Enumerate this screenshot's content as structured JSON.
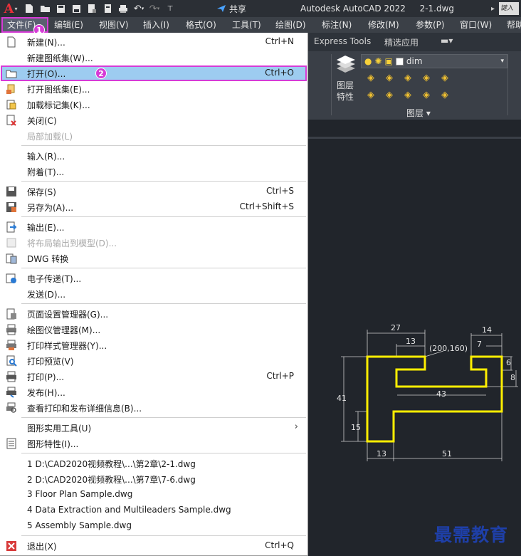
{
  "window": {
    "title": "Autodesk AutoCAD 2022",
    "file": "2-1.dwg",
    "share_label": "共享",
    "search_placeholder": "键入"
  },
  "menubar": [
    {
      "id": "file",
      "label": "文件(F)",
      "active": true
    },
    {
      "id": "edit",
      "label": "编辑(E)"
    },
    {
      "id": "view",
      "label": "视图(V)"
    },
    {
      "id": "insert",
      "label": "插入(I)"
    },
    {
      "id": "format",
      "label": "格式(O)"
    },
    {
      "id": "tools",
      "label": "工具(T)"
    },
    {
      "id": "draw",
      "label": "绘图(D)"
    },
    {
      "id": "dimension",
      "label": "标注(N)"
    },
    {
      "id": "modify",
      "label": "修改(M)"
    },
    {
      "id": "params",
      "label": "参数(P)"
    },
    {
      "id": "window",
      "label": "窗口(W)"
    },
    {
      "id": "help",
      "label": "帮助"
    }
  ],
  "callouts": {
    "one": "1",
    "two": "2"
  },
  "ribbon": {
    "tabs": [
      "Express Tools",
      "精选应用"
    ],
    "layer_name": "dim",
    "layer_props_label": "图层特性",
    "panel_label": "图层 ▾"
  },
  "file_menu": {
    "items": [
      {
        "id": "new",
        "label": "新建(N)...",
        "shortcut": "Ctrl+N",
        "icon": "new-file-icon"
      },
      {
        "id": "new-sheetset",
        "label": "新建图纸集(W)...",
        "icon": ""
      },
      {
        "id": "open",
        "label": "打开(O)...",
        "shortcut": "Ctrl+O",
        "icon": "open-folder-icon",
        "highlight": true
      },
      {
        "id": "open-sheetset",
        "label": "打开图纸集(E)...",
        "icon": "open-sheetset-icon"
      },
      {
        "id": "load-markup",
        "label": "加载标记集(K)...",
        "icon": "markup-icon"
      },
      {
        "id": "close",
        "label": "关闭(C)",
        "icon": "close-file-icon"
      },
      {
        "id": "partial-load",
        "label": "局部加载(L)",
        "disabled": true
      },
      {
        "id": "import",
        "label": "输入(R)...",
        "icon": ""
      },
      {
        "id": "attach",
        "label": "附着(T)...",
        "icon": ""
      },
      {
        "id": "save",
        "label": "保存(S)",
        "shortcut": "Ctrl+S",
        "icon": "save-icon"
      },
      {
        "id": "saveas",
        "label": "另存为(A)...",
        "shortcut": "Ctrl+Shift+S",
        "icon": "save-as-icon"
      },
      {
        "id": "export",
        "label": "输出(E)...",
        "icon": "export-icon"
      },
      {
        "id": "export-layout",
        "label": "将布局输出到模型(D)...",
        "disabled": true,
        "icon": "export-layout-icon"
      },
      {
        "id": "dwg-convert",
        "label": "DWG 转换",
        "icon": "dwg-convert-icon"
      },
      {
        "id": "etransmit",
        "label": "电子传递(T)...",
        "icon": "etransmit-icon"
      },
      {
        "id": "send",
        "label": "发送(D)...",
        "icon": ""
      },
      {
        "id": "page-setup",
        "label": "页面设置管理器(G)...",
        "icon": "page-setup-icon"
      },
      {
        "id": "plotter-mgr",
        "label": "绘图仪管理器(M)...",
        "icon": "plotter-icon"
      },
      {
        "id": "plotstyle-mgr",
        "label": "打印样式管理器(Y)...",
        "icon": "plotstyle-icon"
      },
      {
        "id": "plot-preview",
        "label": "打印预览(V)",
        "icon": "preview-icon"
      },
      {
        "id": "plot",
        "label": "打印(P)...",
        "shortcut": "Ctrl+P",
        "icon": "print-icon"
      },
      {
        "id": "publish",
        "label": "发布(H)...",
        "icon": "publish-icon"
      },
      {
        "id": "plot-details",
        "label": "查看打印和发布详细信息(B)...",
        "icon": "plot-details-icon"
      },
      {
        "id": "drawing-utilities",
        "label": "图形实用工具(U)",
        "submenu": true,
        "icon": ""
      },
      {
        "id": "drawing-props",
        "label": "图形特性(I)...",
        "icon": "properties-icon"
      },
      {
        "id": "recent-1",
        "label": "1 D:\\CAD2020视频教程\\...\\第2章\\2-1.dwg"
      },
      {
        "id": "recent-2",
        "label": "2 D:\\CAD2020视频教程\\...\\第7章\\7-6.dwg"
      },
      {
        "id": "recent-3",
        "label": "3 Floor Plan Sample.dwg"
      },
      {
        "id": "recent-4",
        "label": "4 Data Extraction and Multileaders Sample.dwg"
      },
      {
        "id": "recent-5",
        "label": "5 Assembly Sample.dwg"
      },
      {
        "id": "exit",
        "label": "退出(X)",
        "shortcut": "Ctrl+Q",
        "icon": "exit-icon"
      }
    ]
  },
  "drawing": {
    "dimensions": [
      "27",
      "14",
      "13",
      "7",
      "6",
      "8",
      "43",
      "41",
      "15",
      "13",
      "51"
    ],
    "coord_label": "(200,160)"
  },
  "watermark": "最需教育",
  "colors": {
    "highlight": "#9dccf0",
    "callout": "#d63bd6",
    "shape": "#ffee00"
  }
}
